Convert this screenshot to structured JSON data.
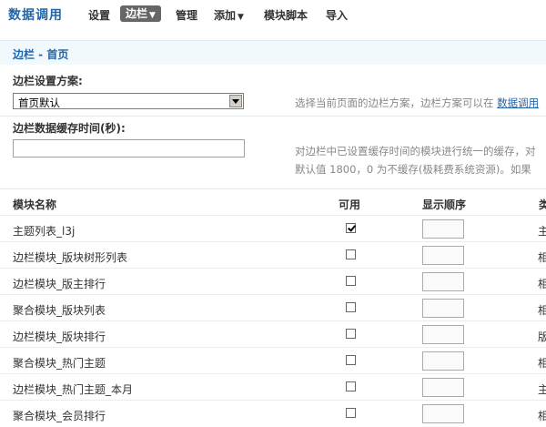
{
  "nav": {
    "brand": "数据调用",
    "items": [
      {
        "label": "设置",
        "dropdown": false,
        "active": false
      },
      {
        "label": "边栏",
        "dropdown": true,
        "active": true
      },
      {
        "label": "管理",
        "dropdown": false,
        "active": false
      },
      {
        "label": "添加",
        "dropdown": true,
        "active": false
      },
      {
        "label": "模块脚本",
        "dropdown": false,
        "active": false
      },
      {
        "label": "导入",
        "dropdown": false,
        "active": false
      }
    ]
  },
  "page": {
    "title": "边栏 - 首页"
  },
  "scheme": {
    "label": "边栏设置方案:",
    "selected": "首页默认",
    "hint_prefix": "选择当前页面的边栏方案，边栏方案可以在",
    "hint_link": "数据调用"
  },
  "cache": {
    "label": "边栏数据缓存时间(秒):",
    "value": "",
    "hint_line1": "对边栏中已设置缓存时间的模块进行统一的缓存，对",
    "hint_line2": "默认值 1800，0 为不缓存(极耗费系统资源)。如果"
  },
  "table": {
    "headers": {
      "name": "模块名称",
      "enabled": "可用",
      "order": "显示顺序",
      "type": "类"
    },
    "rows": [
      {
        "name": "主题列表_l3j",
        "checked": true,
        "order": "",
        "type": "主"
      },
      {
        "name": "边栏模块_版块树形列表",
        "checked": false,
        "order": "",
        "type": "相"
      },
      {
        "name": "边栏模块_版主排行",
        "checked": false,
        "order": "",
        "type": "相"
      },
      {
        "name": "聚合模块_版块列表",
        "checked": false,
        "order": "",
        "type": "相"
      },
      {
        "name": "边栏模块_版块排行",
        "checked": false,
        "order": "",
        "type": "版"
      },
      {
        "name": "聚合模块_热门主题",
        "checked": false,
        "order": "",
        "type": "相"
      },
      {
        "name": "边栏模块_热门主题_本月",
        "checked": false,
        "order": "",
        "type": "主"
      },
      {
        "name": "聚合模块_会员排行",
        "checked": false,
        "order": "",
        "type": "相"
      }
    ]
  }
}
